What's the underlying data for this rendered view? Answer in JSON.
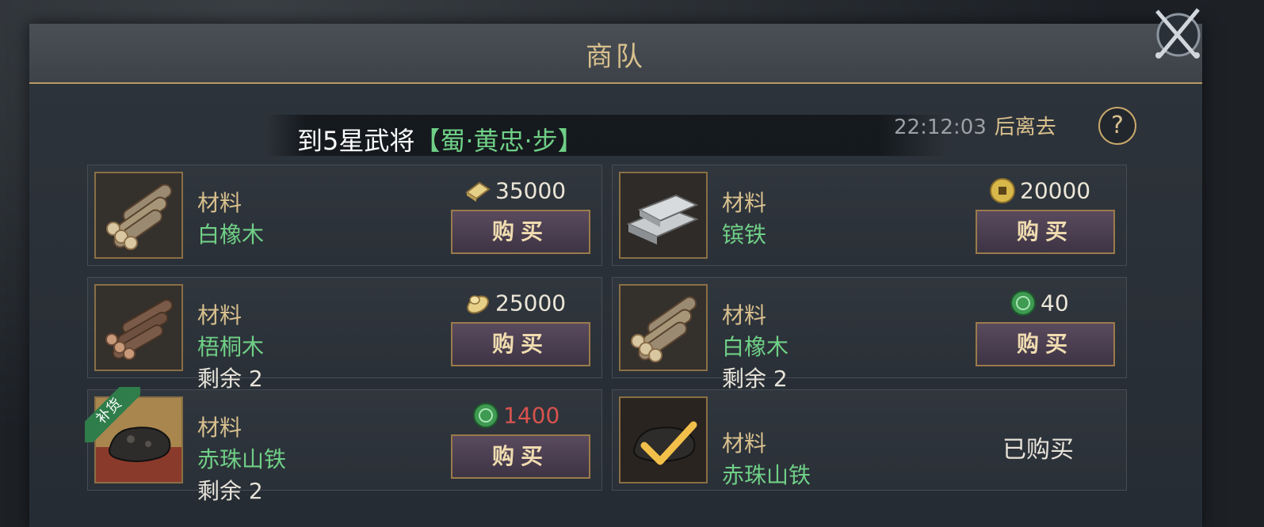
{
  "header": {
    "title": "商队"
  },
  "notice": {
    "prefix": "到5星武将",
    "hero": "【蜀·黄忠·步】"
  },
  "timer": {
    "time": "22:12:03",
    "label": "后离去"
  },
  "help": {
    "label": "?"
  },
  "cards": [
    {
      "category": "材料",
      "name": "白橡木",
      "remaining": "",
      "currency_icon": "silver-ingot-icon",
      "price": "35000",
      "price_color": "#ece6d8",
      "button": "购买",
      "item_icon": "white-oak-logs-icon"
    },
    {
      "category": "材料",
      "name": "镔铁",
      "remaining": "",
      "currency_icon": "copper-coin-icon",
      "price": "20000",
      "price_color": "#ece6d8",
      "button": "购买",
      "item_icon": "iron-bars-icon"
    },
    {
      "category": "材料",
      "name": "梧桐木",
      "remaining": "剩余 2",
      "currency_icon": "bread-roll-icon",
      "price": "25000",
      "price_color": "#ece6d8",
      "button": "购买",
      "item_icon": "wutong-logs-icon"
    },
    {
      "category": "材料",
      "name": "白橡木",
      "remaining": "剩余 2",
      "currency_icon": "jade-coin-icon",
      "price": "40",
      "price_color": "#ece6d8",
      "button": "购买",
      "item_icon": "white-oak-logs-icon"
    },
    {
      "category": "材料",
      "name": "赤珠山铁",
      "remaining": "剩余 2",
      "currency_icon": "jade-coin-icon",
      "price": "1400",
      "price_color": "#d9534f",
      "button": "购买",
      "item_icon": "meteor-iron-icon",
      "tag": "补货"
    },
    {
      "category": "材料",
      "name": "赤珠山铁",
      "remaining": "",
      "status": "已购买",
      "item_icon": "meteor-iron-icon"
    }
  ]
}
